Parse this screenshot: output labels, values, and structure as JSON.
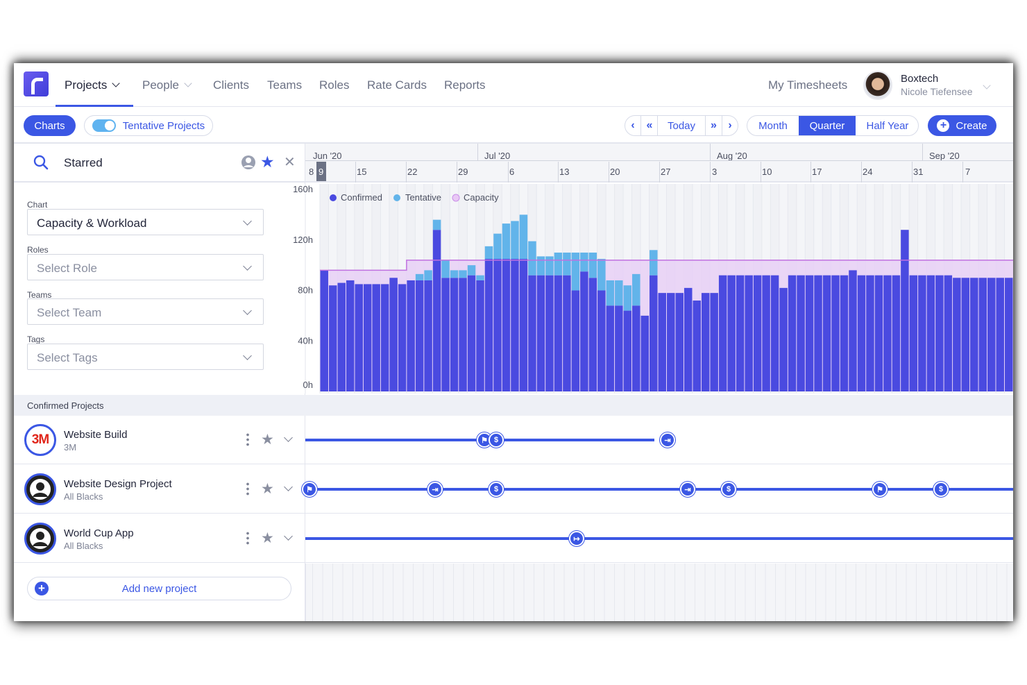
{
  "nav": {
    "items": [
      {
        "label": "Projects",
        "dropdown": true,
        "active": true
      },
      {
        "label": "People",
        "dropdown": true,
        "active": false
      },
      {
        "label": "Clients",
        "dropdown": false,
        "active": false
      },
      {
        "label": "Teams",
        "dropdown": false,
        "active": false
      },
      {
        "label": "Roles",
        "dropdown": false,
        "active": false
      },
      {
        "label": "Rate Cards",
        "dropdown": false,
        "active": false
      },
      {
        "label": "Reports",
        "dropdown": false,
        "active": false
      }
    ],
    "timesheets": "My Timesheets",
    "account": {
      "company": "Boxtech",
      "user": "Nicole Tiefensee"
    }
  },
  "toolbar": {
    "charts": "Charts",
    "tentative": "Tentative Projects",
    "tentative_on": true,
    "today": "Today",
    "views": [
      "Month",
      "Quarter",
      "Half Year"
    ],
    "active_view": "Quarter",
    "create": "Create"
  },
  "filter": {
    "search": "Starred",
    "chart_label": "Chart",
    "chart_value": "Capacity & Workload",
    "roles_label": "Roles",
    "roles_placeholder": "Select Role",
    "teams_label": "Teams",
    "teams_placeholder": "Select Team",
    "tags_label": "Tags",
    "tags_placeholder": "Select Tags"
  },
  "timeline": {
    "months": [
      "Jun '20",
      "Jul '20",
      "Aug '20",
      "Sep '20"
    ],
    "weeks": [
      "8",
      "9",
      "15",
      "22",
      "29",
      "6",
      "13",
      "20",
      "27",
      "3",
      "10",
      "17",
      "24",
      "31",
      "7"
    ],
    "today": "9"
  },
  "colors": {
    "accent": "#3b57e4",
    "confirmed": "#4a4ae0",
    "tentative": "#62b4ea",
    "capacity": "#c98ee8"
  },
  "chart_data": {
    "type": "bar",
    "stacked": true,
    "y_ticks": [
      "0h",
      "40h",
      "80h",
      "120h",
      "160h"
    ],
    "ylim": [
      0,
      160
    ],
    "legend": [
      "Confirmed",
      "Tentative",
      "Capacity"
    ],
    "series": [
      {
        "name": "Confirmed",
        "values": [
          96,
          84,
          86,
          88,
          85,
          85,
          85,
          85,
          90,
          85,
          88,
          88,
          88,
          128,
          90,
          90,
          90,
          92,
          88,
          105,
          105,
          105,
          105,
          105,
          92,
          92,
          92,
          92,
          92,
          80,
          95,
          90,
          80,
          68,
          68,
          64,
          68,
          60,
          92,
          78,
          78,
          78,
          82,
          72,
          78,
          78,
          92,
          92,
          92,
          92,
          92,
          92,
          92,
          82,
          92,
          92,
          92,
          92,
          92,
          92,
          92,
          96,
          92,
          92,
          92,
          92,
          92,
          128,
          92,
          92,
          92,
          92,
          92,
          90,
          90,
          90,
          90,
          90,
          90,
          90
        ]
      },
      {
        "name": "Tentative",
        "values": [
          0,
          0,
          0,
          0,
          0,
          0,
          0,
          0,
          0,
          0,
          0,
          5,
          8,
          8,
          14,
          6,
          6,
          8,
          4,
          10,
          20,
          28,
          30,
          35,
          27,
          15,
          15,
          18,
          18,
          30,
          15,
          20,
          25,
          20,
          20,
          20,
          25,
          0,
          20,
          0,
          0,
          0,
          0,
          0,
          0,
          0,
          0,
          0,
          0,
          0,
          0,
          0,
          0,
          0,
          0,
          0,
          0,
          0,
          0,
          0,
          0,
          0,
          0,
          0,
          0,
          0,
          0,
          0,
          0,
          0,
          0,
          0,
          0,
          0,
          0,
          0,
          0,
          0,
          0,
          0
        ]
      },
      {
        "name": "Capacity",
        "values": [
          96,
          96,
          96,
          96,
          96,
          96,
          96,
          96,
          96,
          96,
          104,
          104,
          104,
          104,
          104,
          104,
          104,
          104,
          104,
          104,
          104,
          104,
          104,
          104,
          104,
          104,
          104,
          104,
          104,
          104,
          104,
          104,
          104,
          104,
          104,
          104,
          104,
          104,
          104,
          104,
          104,
          104,
          104,
          104,
          104,
          104,
          104,
          104,
          104,
          104,
          104,
          104,
          104,
          104,
          104,
          104,
          104,
          104,
          104,
          104,
          104,
          104,
          104,
          104,
          104,
          104,
          104,
          104,
          104,
          104,
          104,
          104,
          104,
          104,
          104,
          104,
          104,
          104,
          104,
          104
        ]
      }
    ]
  },
  "projects_header": "Confirmed Projects",
  "projects": [
    {
      "name": "Website Build",
      "client": "3M"
    },
    {
      "name": "Website Design Project",
      "client": "All Blacks"
    },
    {
      "name": "World Cup App",
      "client": "All Blacks"
    }
  ],
  "add_project": "Add new project"
}
